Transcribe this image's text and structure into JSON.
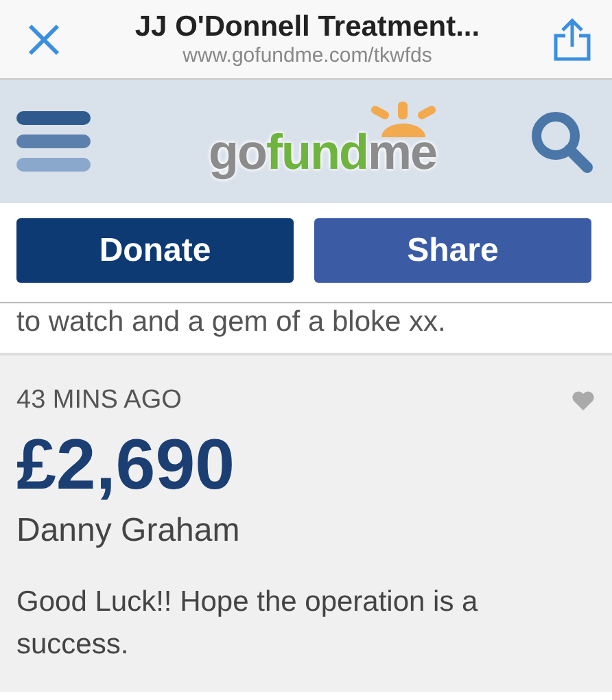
{
  "browser_bar": {
    "title": "JJ O'Donnell Treatment...",
    "url": "www.gofundme.com/tkwfds"
  },
  "site_header": {
    "logo": [
      {
        "text": "go",
        "color": "#8c8c8c"
      },
      {
        "text": "fund",
        "color": "#6fb43f"
      },
      {
        "text": "me",
        "color": "#8c8c8c"
      }
    ]
  },
  "actions": [
    "Donate",
    "Share"
  ],
  "previous_comment_tail": "to watch and a gem of a bloke xx.",
  "donation": {
    "time": "43 MINS AGO",
    "liked": false,
    "amount": "£2,690",
    "donor": "Danny Graham",
    "message": "Good Luck!! Hope the operation is a success."
  }
}
